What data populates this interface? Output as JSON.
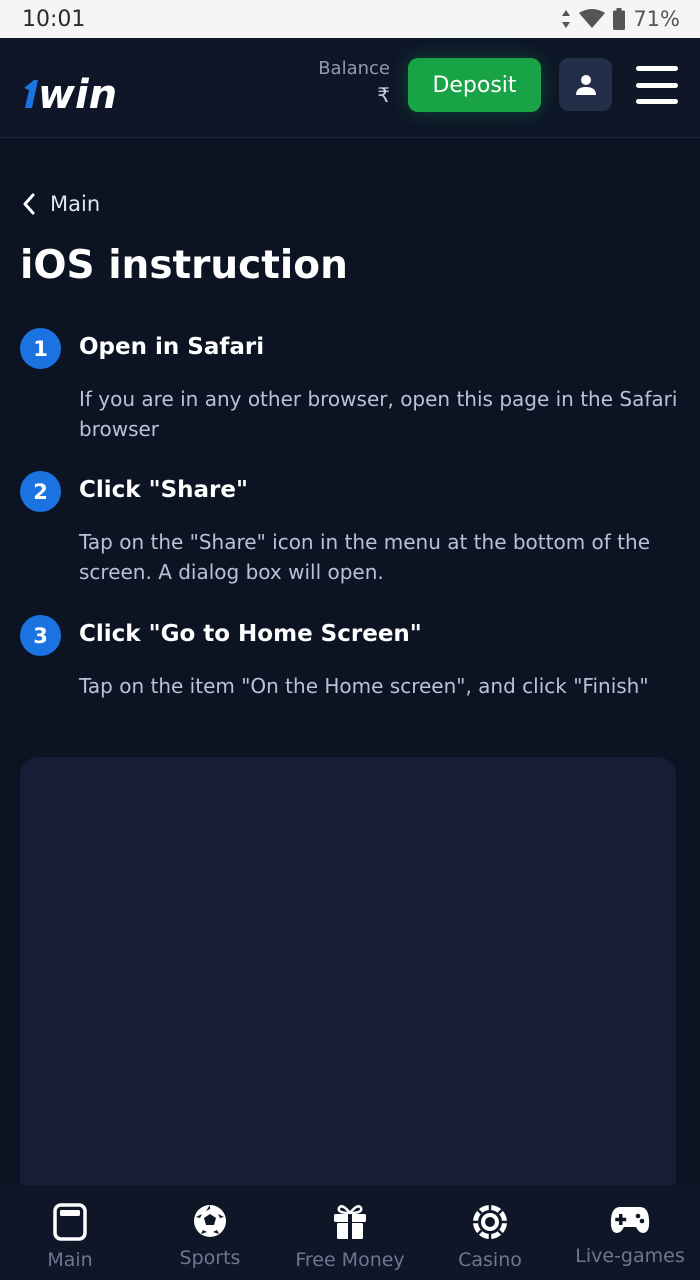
{
  "status_bar": {
    "time": "10:01",
    "battery": "71%"
  },
  "header": {
    "logo_text": "1win",
    "balance_label": "Balance",
    "balance_value": "₹",
    "deposit_label": "Deposit"
  },
  "nav_back": {
    "label": "Main"
  },
  "page": {
    "title": "iOS instruction",
    "steps": [
      {
        "number": "1",
        "title": "Open in Safari",
        "description": "If you are in any other browser, open this page in the Safari browser"
      },
      {
        "number": "2",
        "title": "Click \"Share\"",
        "description": "Tap on the \"Share\" icon in the menu at the bottom of the screen. A dialog box will open."
      },
      {
        "number": "3",
        "title": "Click \"Go to Home Screen\"",
        "description": "Tap on the item \"On the Home screen\", and click \"Finish\""
      }
    ]
  },
  "bottom_nav": {
    "items": [
      {
        "label": "Main",
        "icon": "main-icon"
      },
      {
        "label": "Sports",
        "icon": "soccer-ball-icon"
      },
      {
        "label": "Free Money",
        "icon": "gift-icon"
      },
      {
        "label": "Casino",
        "icon": "casino-chip-icon"
      },
      {
        "label": "Live-games",
        "icon": "gamepad-icon"
      }
    ]
  },
  "colors": {
    "background": "#0c1424",
    "accent_green": "#17a346",
    "step_blue": "#1a73e0",
    "panel": "#161e36"
  }
}
